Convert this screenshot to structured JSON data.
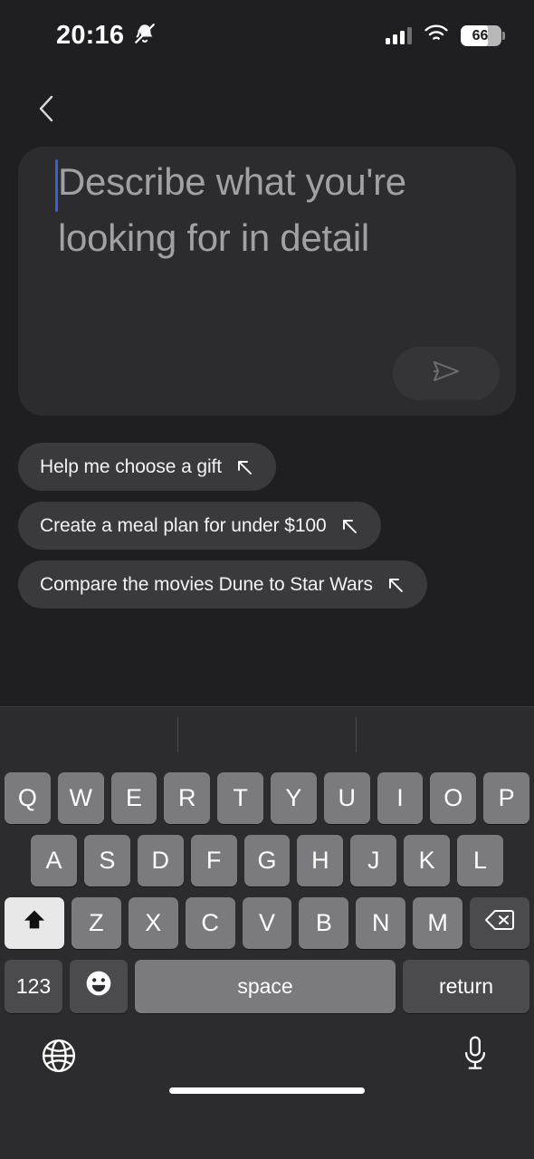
{
  "status_bar": {
    "time": "20:16",
    "silent_icon": "bell-slash-icon",
    "signal_icon": "cellular-signal-icon",
    "wifi_icon": "wifi-icon",
    "battery_level": "66",
    "battery_percent": 66
  },
  "nav": {
    "back_icon": "chevron-left-icon"
  },
  "composer": {
    "placeholder": "Describe what you're looking for in detail",
    "value": "",
    "send_icon": "send-icon",
    "send_label": ""
  },
  "suggestions": [
    {
      "label": "Help me choose a gift",
      "icon": "arrow-up-left-icon"
    },
    {
      "label": "Create a meal plan for under $100",
      "icon": "arrow-up-left-icon"
    },
    {
      "label": "Compare the movies Dune to Star Wars",
      "icon": "arrow-up-left-icon"
    }
  ],
  "keyboard": {
    "row1": [
      "Q",
      "W",
      "E",
      "R",
      "T",
      "Y",
      "U",
      "I",
      "O",
      "P"
    ],
    "row2": [
      "A",
      "S",
      "D",
      "F",
      "G",
      "H",
      "J",
      "K",
      "L"
    ],
    "row3": [
      "Z",
      "X",
      "C",
      "V",
      "B",
      "N",
      "M"
    ],
    "shift_icon": "shift-up-arrow-icon",
    "backspace_icon": "backspace-delete-icon",
    "numbers_label": "123",
    "emoji_icon": "emoji-smiley-icon",
    "space_label": "space",
    "return_label": "return",
    "globe_icon": "globe-language-icon",
    "mic_icon": "microphone-icon"
  },
  "colors": {
    "app_background": "#1f1f22",
    "composer_background": "#2c2c2f",
    "chip_background": "#3a3a3e",
    "keyboard_background": "#2c2c2e",
    "key_background": "#7b7b7f",
    "key_special_background": "#4b4b4e",
    "caret": "#3a60d8",
    "placeholder_text": "#a0a0a6"
  }
}
